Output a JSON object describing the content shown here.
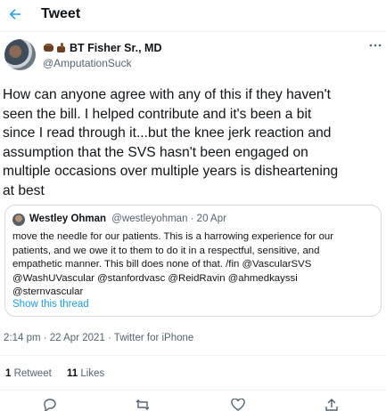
{
  "header": {
    "title": "Tweet"
  },
  "tweet": {
    "author_name": "BT Fisher Sr., MD",
    "author_handle": "@AmputationSuck",
    "text": "How can anyone agree with any of this if they haven't\nseen the bill.  I helped contribute and it's been a bit\nsince I read through it...but the knee jerk reaction and\nassumption that the SVS hasn't been engaged on\nmultiple occasions over multiple years is disheartening\nat best",
    "timestamp": "2:14 pm · 22 Apr 2021 · Twitter for iPhone"
  },
  "quote": {
    "author_name": "Westley Ohman",
    "meta": "@westleyohman · 20 Apr",
    "text": "move the needle for our patients. This is a harrowing experience for our\npatients, and we owe it to them to do it in a respectful, sensitive, and\nempathetic manner. This bill does none of that. /fin @VascularSVS\n@WashUVascular @stanfordvasc @ReidRavin @ahmedkayssi\n@sternvascular",
    "show_thread": "Show this thread"
  },
  "stats": {
    "retweets_count": "1",
    "retweets_label": "Retweet",
    "likes_count": "11",
    "likes_label": "Likes"
  },
  "colors": {
    "accent": "#1d9bf0",
    "text": "#0f1419",
    "muted": "#536471",
    "border": "#cfd9de"
  }
}
